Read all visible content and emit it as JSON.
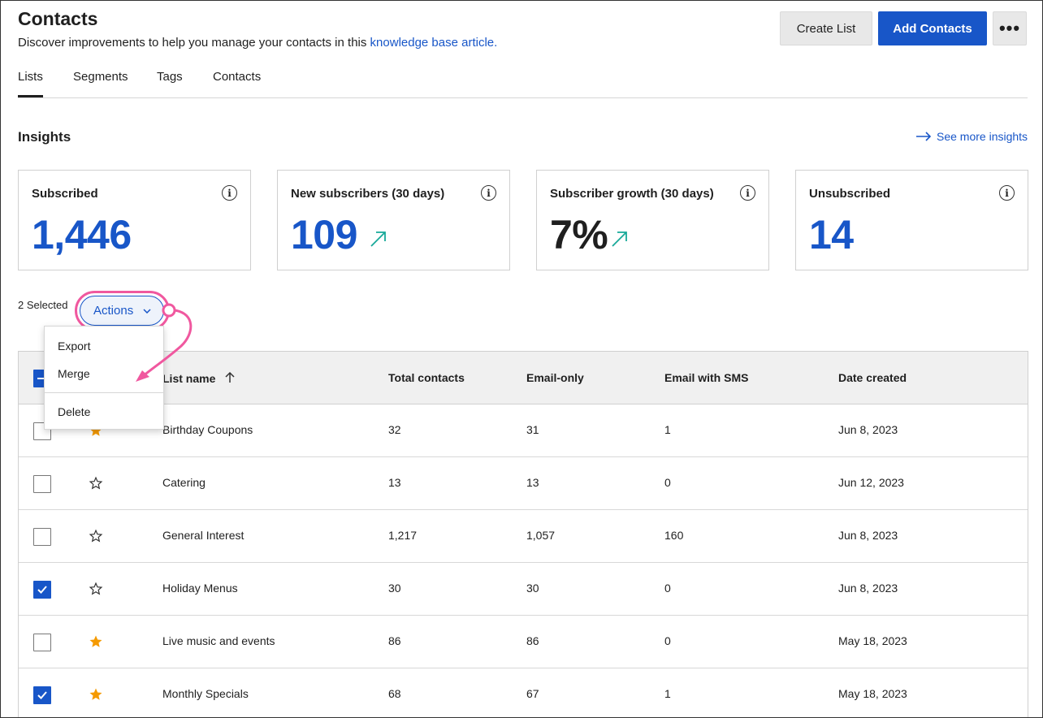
{
  "page": {
    "title": "Contacts",
    "subtitle_prefix": "Discover improvements to help you manage your contacts in this ",
    "subtitle_link": "knowledge base article."
  },
  "toolbar": {
    "create_list_label": "Create List",
    "add_contacts_label": "Add Contacts",
    "more_label": "•••"
  },
  "tabs": [
    {
      "label": "Lists",
      "active": true
    },
    {
      "label": "Segments",
      "active": false
    },
    {
      "label": "Tags",
      "active": false
    },
    {
      "label": "Contacts",
      "active": false
    }
  ],
  "insights": {
    "title": "Insights",
    "see_more": "See more insights",
    "cards": [
      {
        "label": "Subscribed",
        "value": "1,446",
        "trend": false
      },
      {
        "label": "New subscribers (30 days)",
        "value": "109",
        "trend": true
      },
      {
        "label": "Subscriber growth (30 days)",
        "value": "7%",
        "trend": true
      },
      {
        "label": "Unsubscribed",
        "value": "14",
        "trend": false
      }
    ]
  },
  "selection": {
    "selected_text": "2 Selected",
    "actions_label": "Actions"
  },
  "actions_menu": {
    "items": [
      "Export",
      "Merge",
      "Delete"
    ]
  },
  "table": {
    "headers": [
      "List name",
      "Total contacts",
      "Email-only",
      "Email with SMS",
      "Date created"
    ],
    "rows": [
      {
        "name": "Birthday Coupons",
        "total": "32",
        "email_only": "31",
        "email_sms": "1",
        "date": "Jun 8, 2023",
        "checked": false,
        "starred": true
      },
      {
        "name": "Catering",
        "total": "13",
        "email_only": "13",
        "email_sms": "0",
        "date": "Jun 12, 2023",
        "checked": false,
        "starred": false
      },
      {
        "name": "General Interest",
        "total": "1,217",
        "email_only": "1,057",
        "email_sms": "160",
        "date": "Jun 8, 2023",
        "checked": false,
        "starred": false
      },
      {
        "name": "Holiday Menus",
        "total": "30",
        "email_only": "30",
        "email_sms": "0",
        "date": "Jun 8, 2023",
        "checked": true,
        "starred": false
      },
      {
        "name": "Live music and events",
        "total": "86",
        "email_only": "86",
        "email_sms": "0",
        "date": "May 18, 2023",
        "checked": false,
        "starred": true
      },
      {
        "name": "Monthly Specials",
        "total": "68",
        "email_only": "67",
        "email_sms": "1",
        "date": "May 18, 2023",
        "checked": true,
        "starred": true
      }
    ]
  },
  "colors": {
    "primary": "#1856c8",
    "star": "#f59a00",
    "trend": "#18a999",
    "annotation": "#f0589f"
  }
}
